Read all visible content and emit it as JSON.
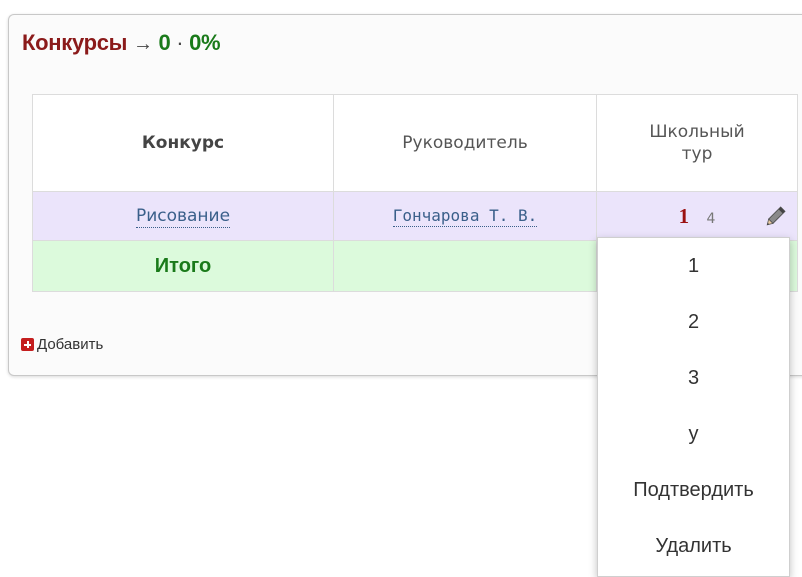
{
  "header": {
    "title": "Конкурсы",
    "arrow": "→",
    "count": "0",
    "separator": "·",
    "percent": "0%"
  },
  "table": {
    "headers": [
      "Конкурс",
      "Руководитель",
      "Школьный тур"
    ],
    "row": {
      "contest": "Рисование",
      "leader": "Гончарова Т. В.",
      "score": "1",
      "score_sub": "4"
    },
    "total_label": "Итого"
  },
  "actions": {
    "add_label": "Добавить"
  },
  "dropdown": {
    "items": [
      "1",
      "2",
      "3",
      "у",
      "Подтвердить",
      "Удалить"
    ]
  },
  "colors": {
    "title": "#8b1a1a",
    "green": "#1a7a1a",
    "row_highlight": "#ebe4fb",
    "total_row": "#dcfadc",
    "score": "#9b1111",
    "add_icon": "#c41e1e"
  }
}
